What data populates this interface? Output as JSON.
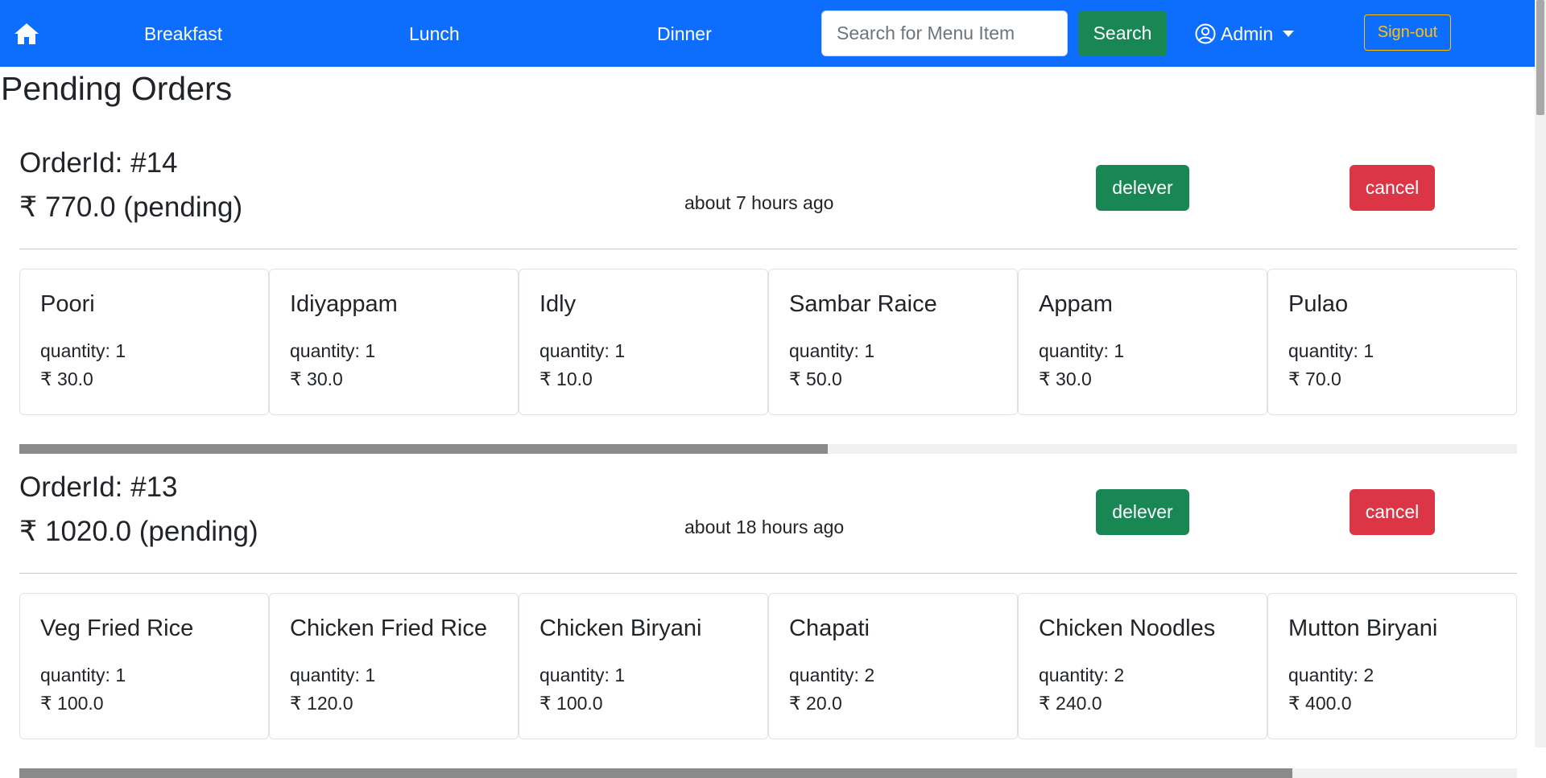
{
  "navbar": {
    "home_icon": "home-icon",
    "links": [
      "Breakfast",
      "Lunch",
      "Dinner"
    ],
    "search": {
      "placeholder": "Search for Menu Item",
      "value": "",
      "button_label": "Search"
    },
    "user": {
      "icon": "user-circle-icon",
      "label": "Admin"
    },
    "signout_label": "Sign-out",
    "colors": {
      "bar": "#0d6efd",
      "search_button": "#198754",
      "signout": "#ffc107"
    }
  },
  "page": {
    "title": "Pending Orders"
  },
  "orders": [
    {
      "id_label": "OrderId: #14",
      "total_label": "₹ 770.0 (pending)",
      "time": "about 7 hours ago",
      "deliver_label": "delever",
      "cancel_label": "cancel",
      "scroll_fraction": 0.54,
      "items": [
        {
          "name": "Poori",
          "quantity": "quantity: 1",
          "price": "₹ 30.0"
        },
        {
          "name": "Idiyappam",
          "quantity": "quantity: 1",
          "price": "₹ 30.0"
        },
        {
          "name": "Idly",
          "quantity": "quantity: 1",
          "price": "₹ 10.0"
        },
        {
          "name": "Sambar Raice",
          "quantity": "quantity: 1",
          "price": "₹ 50.0"
        },
        {
          "name": "Appam",
          "quantity": "quantity: 1",
          "price": "₹ 30.0"
        },
        {
          "name": "Pulao",
          "quantity": "quantity: 1",
          "price": "₹ 70.0"
        }
      ]
    },
    {
      "id_label": "OrderId: #13",
      "total_label": "₹ 1020.0 (pending)",
      "time": "about 18 hours ago",
      "deliver_label": "delever",
      "cancel_label": "cancel",
      "scroll_fraction": 0.85,
      "items": [
        {
          "name": "Veg Fried Rice",
          "quantity": "quantity: 1",
          "price": "₹ 100.0"
        },
        {
          "name": "Chicken Fried Rice",
          "quantity": "quantity: 1",
          "price": "₹ 120.0"
        },
        {
          "name": "Chicken Biryani",
          "quantity": "quantity: 1",
          "price": "₹ 100.0"
        },
        {
          "name": "Chapati",
          "quantity": "quantity: 2",
          "price": "₹ 20.0"
        },
        {
          "name": "Chicken Noodles",
          "quantity": "quantity: 2",
          "price": "₹ 240.0"
        },
        {
          "name": "Mutton Biryani",
          "quantity": "quantity: 2",
          "price": "₹ 400.0"
        }
      ]
    }
  ],
  "status_colors": {
    "deliver": "#198754",
    "cancel": "#dc3545"
  }
}
